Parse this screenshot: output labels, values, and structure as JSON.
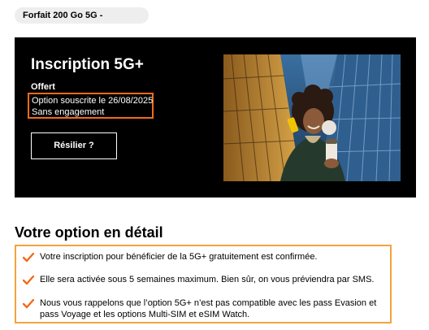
{
  "plan": {
    "label": "Forfait 200 Go 5G -"
  },
  "hero": {
    "title": "Inscription 5G+",
    "status": "Offert",
    "subscribed": "Option souscrite le 26/08/2025",
    "commitment": "Sans engagement",
    "cancel_button": "Résilier ?"
  },
  "details": {
    "title": "Votre option en détail",
    "items": [
      "Votre inscription pour bénéficier de la 5G+ gratuitement est confirmée.",
      "Elle sera activée sous 5 semaines maximum. Bien sûr, on vous préviendra par SMS.",
      "Nous vous rappelons que l’option 5G+ n’est pas compatible avec les pass Evasion et pass Voyage et les options Multi-SIM et eSIM Watch."
    ]
  },
  "colors": {
    "accent": "#f26a1b",
    "highlight_border": "#f4a340",
    "hero_bg": "#000000"
  },
  "icons": {
    "check": "check-icon"
  }
}
